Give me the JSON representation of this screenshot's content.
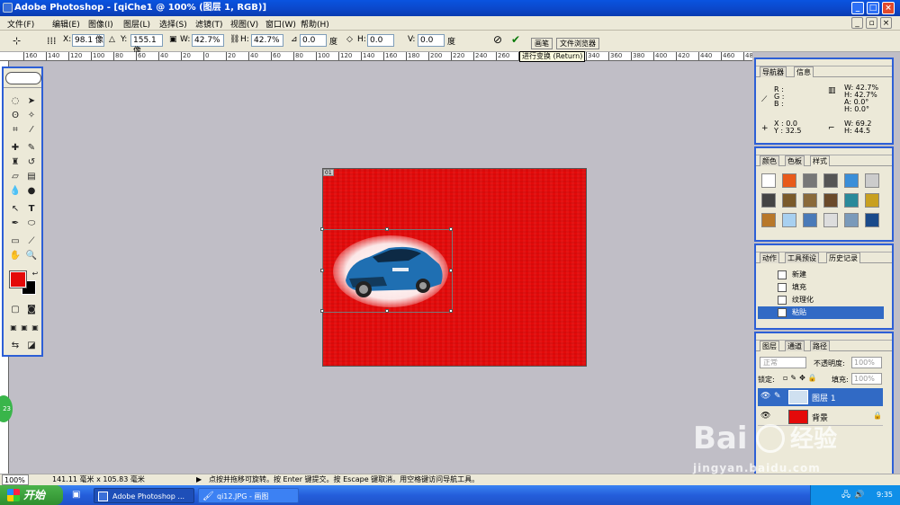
{
  "window": {
    "title": "Adobe Photoshop - [qiChe1 @ 100% (图层 1, RGB)]",
    "controls": [
      "_",
      "□",
      "×"
    ]
  },
  "menu": [
    "文件(F)",
    "编辑(E)",
    "图像(I)",
    "图层(L)",
    "选择(S)",
    "滤镜(T)",
    "视图(V)",
    "窗口(W)",
    "帮助(H)"
  ],
  "options": {
    "x_label": "X:",
    "x_value": "98.1 像",
    "y_label": "Y:",
    "y_value": "155.1 像",
    "w_label": "W:",
    "w_value": "42.7%",
    "h_label": "H:",
    "h_value": "42.7%",
    "angle_value": "0.0",
    "angle_unit": "度",
    "hskew_label": "H:",
    "hskew_value": "0.0",
    "vskew_label": "V:",
    "vskew_value": "0.0",
    "skew_unit": "度",
    "tab_brush": "画笔",
    "tab_browser": "文件浏览器",
    "tooltip": "进行变换 (Return)"
  },
  "ruler_ticks": [
    "160",
    "140",
    "120",
    "100",
    "80",
    "60",
    "40",
    "20",
    "0",
    "20",
    "40",
    "60",
    "80",
    "100",
    "120",
    "140",
    "160",
    "180",
    "200",
    "220",
    "240",
    "260",
    "280",
    "300",
    "320",
    "340",
    "360",
    "380",
    "400",
    "420",
    "440",
    "460",
    "480"
  ],
  "doc": {
    "badge": "01"
  },
  "info_panel": {
    "tabs": [
      "导航器",
      "信息"
    ],
    "r": "R :",
    "g": "G :",
    "b": "B :",
    "w1": "W:  42.7%",
    "h1": "H:  42.7%",
    "a": "A:   0.0°",
    "h2": "H:   0.0°",
    "x": "X :    0.0",
    "y": "Y :   32.5",
    "w2": "W:   69.2",
    "h3": "H:   44.5"
  },
  "color_panel": {
    "tabs": [
      "颜色",
      "色板",
      "样式"
    ]
  },
  "history_panel": {
    "tabs": [
      "动作",
      "工具预设",
      "历史记录"
    ],
    "items": [
      "新建",
      "填充",
      "纹理化",
      "粘贴"
    ]
  },
  "layers_panel": {
    "tabs": [
      "图层",
      "通道",
      "路径"
    ],
    "blend": "正常",
    "opacity_label": "不透明度:",
    "opacity_value": "100%",
    "lock_label": "锁定:",
    "fill_label": "填充:",
    "fill_value": "100%",
    "layers": [
      "图层 1",
      "背景"
    ]
  },
  "status": {
    "zoom": "100%",
    "size": "141.11 毫米 x 105.83 毫米",
    "hint": "点按并拖移可旋转。按 Enter 键提交。按 Escape 键取消。用空格键访问导航工具。"
  },
  "taskbar": {
    "start": "开始",
    "items": [
      "Adobe Photoshop ...",
      "qi12.JPG - 画图"
    ],
    "time": "9:35"
  },
  "watermark": {
    "brand": "Bai",
    "cn": "经验",
    "url": "jingyan.baidu.com",
    "side": "23"
  }
}
